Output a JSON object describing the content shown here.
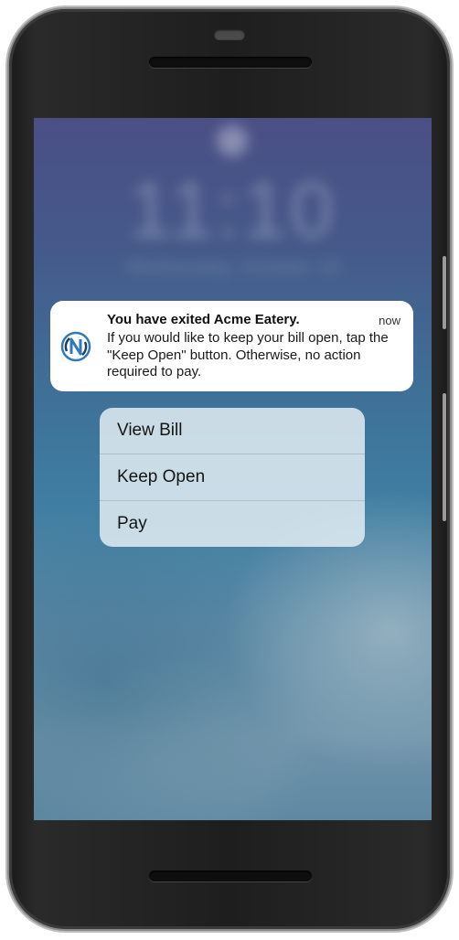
{
  "lockscreen": {
    "time": "11:10",
    "date": "Wednesday, October 18"
  },
  "notification": {
    "app_icon": "nfc-n-logo-icon",
    "title": "You have exited Acme Eatery.",
    "timestamp": "now",
    "body": "If you would like to keep your bill open, tap the \"Keep Open\" button. Otherwise, no action required to pay."
  },
  "actions": [
    {
      "label": "View Bill"
    },
    {
      "label": "Keep Open"
    },
    {
      "label": "Pay"
    }
  ],
  "colors": {
    "icon_blue": "#2f7ab8",
    "icon_dark": "#1f3f66"
  }
}
